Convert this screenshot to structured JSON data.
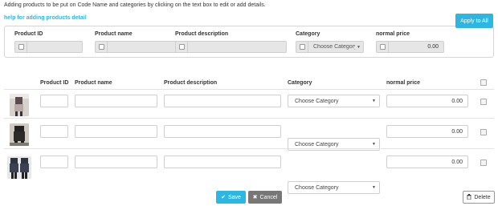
{
  "intro_text": "Adding products to be put on Code Name and categories by clicking on the text box to edit or add details.",
  "help_link": "help for adding products detail",
  "bulk_panel": {
    "labels": {
      "product_id": "Product ID",
      "product_name": "Product name",
      "product_description": "Product description",
      "category": "Category",
      "normal_price": "normal price"
    },
    "category_value": "Choose Category",
    "price_value": "0.00",
    "apply_label": "Apply to All"
  },
  "table": {
    "headers": {
      "product_id": "Product ID",
      "product_name": "Product name",
      "product_description": "Product description",
      "category": "Category",
      "normal_price": "normal price"
    },
    "rows": [
      {
        "product_id": "",
        "product_name": "",
        "product_description": "",
        "category": "Choose Category",
        "normal_price": "0.00"
      },
      {
        "product_id": "",
        "product_name": "",
        "product_description": "",
        "category": "Choose Category",
        "normal_price": "0.00"
      },
      {
        "product_id": "",
        "product_name": "",
        "product_description": "",
        "category": "Choose Category",
        "normal_price": "0.00"
      }
    ]
  },
  "buttons": {
    "save": "Save",
    "cancel": "Cancel",
    "delete": "Delete"
  },
  "icons": {
    "save": "check-icon",
    "cancel": "x-icon",
    "delete": "trash-icon",
    "dropdown": "caret-down-icon"
  },
  "colors": {
    "accent": "#2bb6e3",
    "cancel_bg": "#777777",
    "disabled_input": "#e6e6e6"
  }
}
